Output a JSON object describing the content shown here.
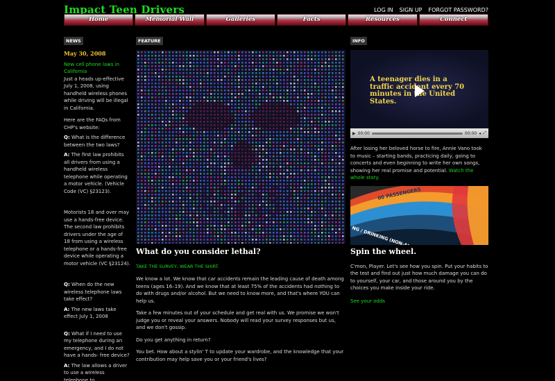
{
  "site": {
    "logo": "Impact Teen Drivers"
  },
  "toplinks": [
    "LOG IN",
    "SIGN UP",
    "FORGOT PASSWORD?"
  ],
  "nav": [
    "Home",
    "Memorial Wall",
    "Galleries",
    "Facts",
    "Resources",
    "Connect"
  ],
  "labels": {
    "news": "NEWS",
    "feature": "FEATURE",
    "info": "INFO"
  },
  "news": {
    "date": "May 30, 2008",
    "headline": "New cell phone laws in California",
    "intro": "Just a heads up-effective July 1, 2008, using handheld wireless phones while driving will be illegal in California.",
    "faq_intro": "Here are the FAQs from CHP's website:",
    "q1": "What is the difference between the two laws?",
    "a1": "The first law prohibits all drivers from using a handheld wireless telephone while operating a motor vehicle. (Vehicle Code (VC) §23123).",
    "p2": "Motorists 18 and over may use a hands-free device. The second law prohibits drivers under the age of 18 from using a wireless telephone or a hands-free device while operating a motor vehicle (VC §23124).",
    "q2": "When do the new wireless telephone laws take effect?",
    "a2": "The new laws take effect July 1, 2008",
    "q3": "What if I need to use my telephone during an emergency, and I do not have a hands- free device?",
    "a3": "The law allows a driver to use a wireless telephone to",
    "q_prefix": "Q:",
    "a_prefix": "A:"
  },
  "feature": {
    "heading": "What do you consider lethal?",
    "survey_link": "TAKE THE SURVEY, WEAR THE SHIRT.",
    "p1": "We know a lot. We know that car accidents remain the leading cause of death among teens (ages 16–19). And we know that at least 75% of the accidents had nothing to do with drugs and/or alcohol. But we need to know more, and that's where YOU can help us.",
    "p2": "Take a few minutes out of your schedule and get real with us. We promise we won't judge you or reveal your answers. Nobody will read your survey responses but us, and we don't gossip.",
    "p3": "Do you get anything in return?",
    "p4": "You bet. How about a stylin' T to update your wardrobe, and the knowledge that your contribution may help save you or your friend's lives?"
  },
  "info": {
    "video_caption": "A teenager dies in a traffic accident every 70 minutes in the United States.",
    "time_start": "00:00",
    "time_end": "00:00",
    "story_text": "After losing her beloved horse to fire, Annie Vano took to music – starting bands, practicing daily, going to concerts and even beginning to write her own songs, showing her real promise and potential.",
    "story_link": "Watch the whole story.",
    "wheel_label_1": "00 PASSENGERS",
    "wheel_label_2": "NG / DRINKING (NON-AL",
    "spin_heading": "Spin the wheel.",
    "spin_text": "C'mon, Player. Let's see how you spin. Put your habits to the test and find out just how much damage you can do to yourself, your car, and those around you by the choices you make inside your ride.",
    "odds_link": "See your odds"
  },
  "colors": {
    "accent_green": "#1fdc1f",
    "date_gold": "#f1c232",
    "nav_red": "#b03545"
  }
}
